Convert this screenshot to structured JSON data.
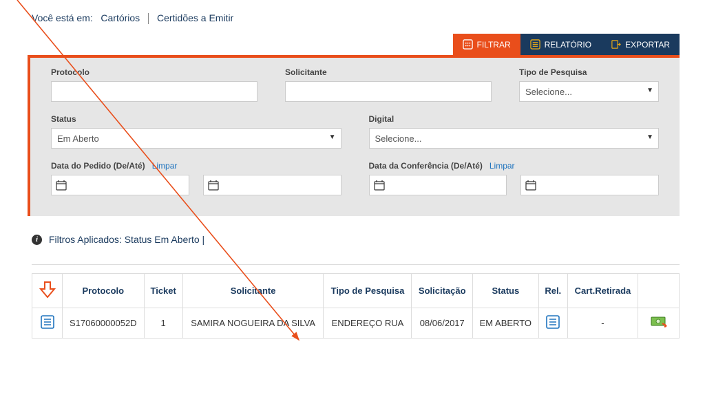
{
  "breadcrumb": {
    "prefix": "Você está em:",
    "item1": "Cartórios",
    "item2": "Certidões a Emitir"
  },
  "actions": {
    "filter": "FILTRAR",
    "report": "RELATÓRIO",
    "export": "EXPORTAR"
  },
  "filters": {
    "protocolo_label": "Protocolo",
    "solicitante_label": "Solicitante",
    "tipo_pesquisa_label": "Tipo de Pesquisa",
    "tipo_pesquisa_value": "Selecione...",
    "status_label": "Status",
    "status_value": "Em Aberto",
    "digital_label": "Digital",
    "digital_value": "Selecione...",
    "data_pedido_label": "Data do Pedido (De/Até)",
    "data_conf_label": "Data da Conferência (De/Até)",
    "limpar": "Limpar"
  },
  "applied": {
    "text": "Filtros Aplicados: Status Em Aberto |"
  },
  "table": {
    "headers": {
      "protocolo": "Protocolo",
      "ticket": "Ticket",
      "solicitante": "Solicitante",
      "tipo": "Tipo de Pesquisa",
      "solicitacao": "Solicitação",
      "status": "Status",
      "rel": "Rel.",
      "cart": "Cart.Retirada"
    },
    "row": {
      "protocolo": "S17060000052D",
      "ticket": "1",
      "solicitante": "SAMIRA NOGUEIRA DA SILVA",
      "tipo": "ENDEREÇO RUA",
      "solicitacao": "08/06/2017",
      "status": "EM ABERTO",
      "cart": "-"
    }
  }
}
